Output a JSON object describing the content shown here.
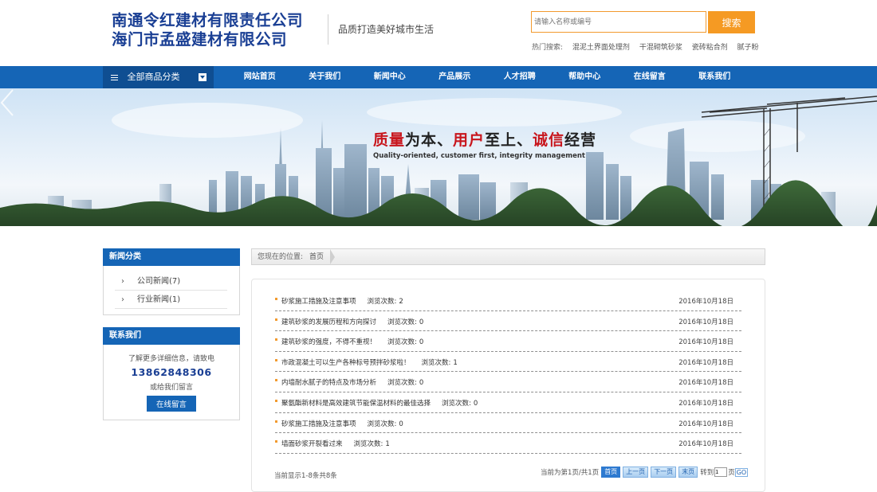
{
  "header": {
    "logo_line1": "南通令红建材有限责任公司",
    "logo_line2": "海门市孟盛建材有限公司",
    "slogan": "品质打造美好城市生活",
    "search_placeholder": "请输入名称或编号",
    "search_button": "搜索",
    "hot_label": "热门搜索:",
    "hot_links": [
      "混泥土界面处理剂",
      "干混砌筑砂浆",
      "瓷砖粘合剂",
      "腻子粉"
    ]
  },
  "nav": {
    "category_label": "全部商品分类",
    "items": [
      "网站首页",
      "关于我们",
      "新闻中心",
      "产品展示",
      "人才招聘",
      "帮助中心",
      "在线留言",
      "联系我们"
    ]
  },
  "banner": {
    "title_part1": "质量",
    "title_part2": "为本、",
    "title_part3": "用户",
    "title_part4": "至上、",
    "title_part5": "诚信",
    "title_part6": "经营",
    "subtitle": "Quality-oriented, customer first, integrity management"
  },
  "sidebar": {
    "news_head": "新闻分类",
    "categories": [
      "公司新闻(7)",
      "行业新闻(1)"
    ],
    "contact_head": "联系我们",
    "contact_line1": "了解更多详细信息，请致电",
    "phone": "13862848306",
    "contact_line2": "或给我们留言",
    "message_button": "在线留言"
  },
  "breadcrumb": {
    "label": "您现在的位置:",
    "home": "首页"
  },
  "news": {
    "views_label": "浏览次数:",
    "items": [
      {
        "title": "砂浆施工措施及注意事项",
        "views": "2",
        "date": "2016年10月18日"
      },
      {
        "title": "建筑砂浆的发展历程和方向探讨",
        "views": "0",
        "date": "2016年10月18日"
      },
      {
        "title": "建筑砂浆的强度，不得不重视！",
        "views": "0",
        "date": "2016年10月18日"
      },
      {
        "title": "市政混凝土可以生产各种标号预拌砂浆啦！",
        "views": "1",
        "date": "2016年10月18日"
      },
      {
        "title": "内墙耐水腻子的特点及市场分析",
        "views": "0",
        "date": "2016年10月18日"
      },
      {
        "title": "聚氨酯新材料是高效建筑节能保温材料的最佳选择",
        "views": "0",
        "date": "2016年10月18日"
      },
      {
        "title": "砂浆施工措施及注意事项",
        "views": "0",
        "date": "2016年10月18日"
      },
      {
        "title": "墙面砂浆开裂看过来",
        "views": "1",
        "date": "2016年10月18日"
      }
    ],
    "page_info": "当前显示1-8条共8条",
    "page_status": "当前为第1页/共1页",
    "first": "首页",
    "prev": "上一页",
    "next": "下一页",
    "last": "末页",
    "goto_label": "转到",
    "page_unit": "页",
    "go": "GO"
  },
  "colors": {
    "brand_blue": "#1565b6",
    "accent_orange": "#f59a23",
    "slogan_red": "#c8161d"
  }
}
